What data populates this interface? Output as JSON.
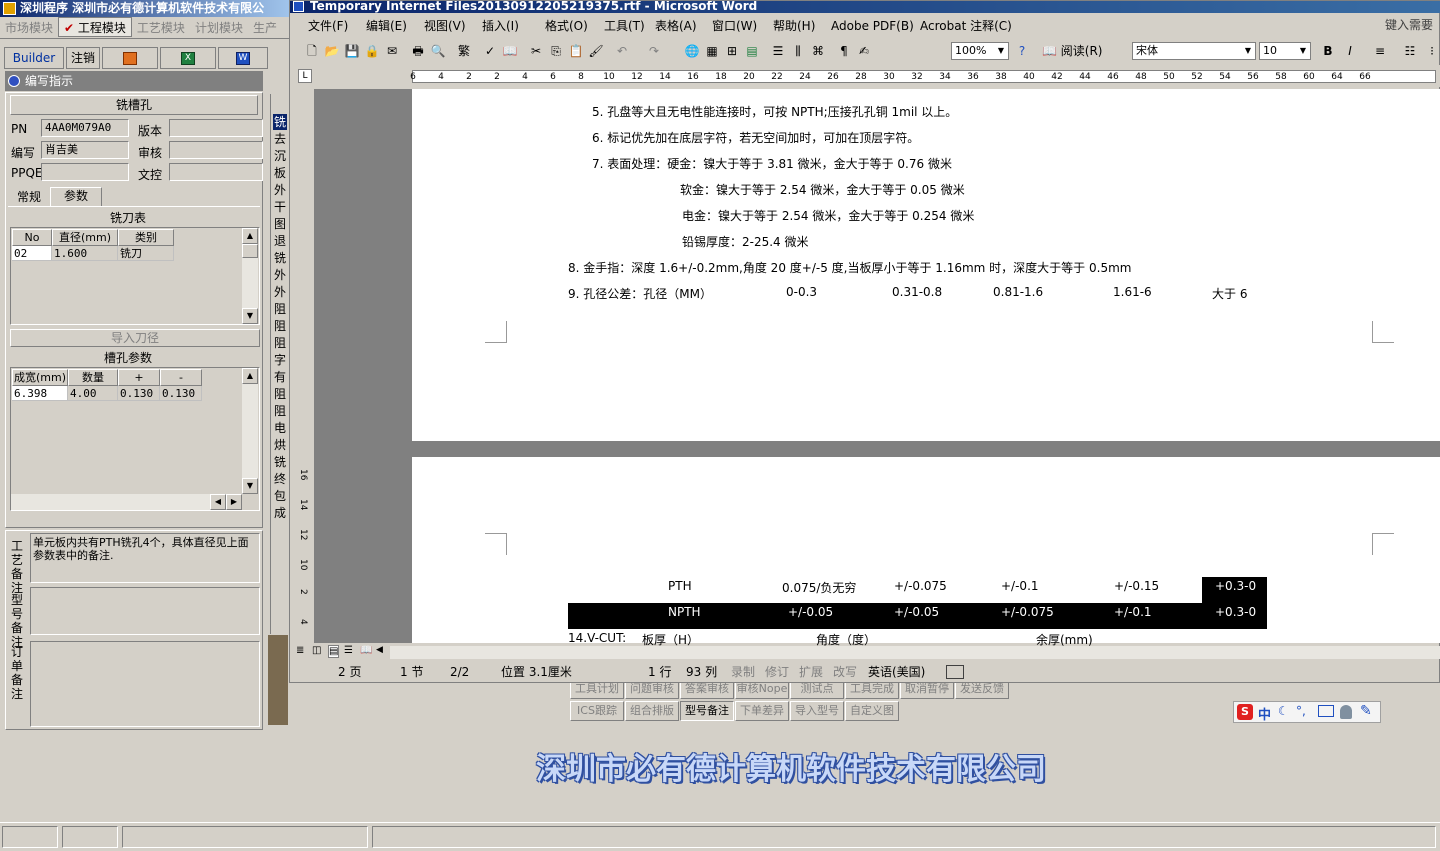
{
  "left_app": {
    "title": "深圳程序   深圳市必有德计算机软件技术有限公",
    "modules": [
      "市场模块",
      "工程模块",
      "工艺模块",
      "计划模块",
      "生产"
    ],
    "toolbar": {
      "builder": "Builder",
      "logout": "注销"
    },
    "panel_title": "编写指示",
    "section_title": "铣槽孔",
    "fields": {
      "pn_label": "PN",
      "pn_value": "4AA0M079A0",
      "version_label": "版本",
      "version_value": "",
      "writer_label": "编写",
      "writer_value": "肖吉美",
      "review_label": "审核",
      "review_value": "",
      "ppqe_label": "PPQE",
      "ppqe_value": "",
      "doccontrol_label": "文控",
      "doccontrol_value": ""
    },
    "tabs": [
      "常规",
      "参数"
    ],
    "mill_table": {
      "title": "铣刀表",
      "headers": [
        "No",
        "直径(mm)",
        "类别"
      ],
      "rows": [
        [
          "02",
          "1.600",
          "铣刀"
        ]
      ]
    },
    "import_button": "导入刀径",
    "slot_table": {
      "title": "槽孔参数",
      "headers": [
        "成宽(mm)",
        "数量",
        "+",
        "-"
      ],
      "rows": [
        [
          "6.398",
          "4.00",
          "0.130",
          "0.130"
        ]
      ]
    },
    "side_strip": [
      "铣",
      "去",
      "沉",
      "板",
      "外",
      "干",
      "图",
      "退",
      "铣",
      "外",
      "外",
      "阻",
      "阻",
      "阻",
      "字",
      "有",
      "阻",
      "阻",
      "电",
      "烘",
      "铣",
      "终",
      "包",
      "成"
    ],
    "notes": {
      "process_label": "工艺备注",
      "process_text": "单元板内共有PTH铣孔4个，具体直径见上面参数表中的备注.",
      "model_label": "型号备注",
      "order_label": "订单备注"
    },
    "bottom_buttons_row1": [
      "工具计划",
      "问题审核",
      "答案审核",
      "审核Nope",
      "测试点",
      "工具完成",
      "取消暂停",
      "发送反馈"
    ],
    "bottom_buttons_row2": [
      "ICS跟踪",
      "组合排版",
      "型号备注",
      "下单差异",
      "导入型号",
      "自定义图"
    ],
    "company": "深圳市必有德计算机软件技术有限公司"
  },
  "word": {
    "title": "Temporary Internet Files20130912205219375.rtf - Microsoft Word",
    "menu": [
      "文件(F)",
      "编辑(E)",
      "视图(V)",
      "插入(I)",
      "格式(O)",
      "工具(T)",
      "表格(A)",
      "窗口(W)",
      "帮助(H)",
      "Adobe PDF(B)",
      "Acrobat 注释(C)"
    ],
    "help_box": "键入需要",
    "zoom": "100%",
    "read_button": "阅读(R)",
    "font_name": "宋体",
    "font_size": "10",
    "ruler_ticks": [
      "6",
      "4",
      "2",
      "2",
      "4",
      "6",
      "8",
      "10",
      "12",
      "14",
      "16",
      "18",
      "20",
      "22",
      "24",
      "26",
      "28",
      "30",
      "32",
      "34",
      "36",
      "38",
      "40",
      "42",
      "44",
      "46",
      "48",
      "50",
      "52",
      "54",
      "56",
      "58",
      "60",
      "64",
      "66"
    ],
    "vruler_ticks": [
      "16",
      "14",
      "12",
      "10",
      "2",
      "4"
    ],
    "doc_lines": [
      "5.  孔盘等大且无电性能连接时，可按 NPTH;压接孔孔铜 1mil 以上。",
      "6.  标记优先加在底层字符，若无空间加时，可加在顶层字符。",
      "7.  表面处理：硬金：镍大于等于 3.81 微米，金大于等于 0.76 微米",
      "软金：镍大于等于 2.54 微米，金大于等于 0.05 微米",
      "电金：镍大于等于 2.54 微米，金大于等于 0.254 微米",
      "铅锡厚度：2-25.4 微米",
      "8.  金手指：深度 1.6+/-0.2mm,角度 20 度+/-5 度,当板厚小于等于 1.16mm 时，深度大于等于 0.5mm"
    ],
    "tolerance": {
      "label": "9.  孔径公差：孔径（MM）",
      "cols": [
        "0-0.3",
        "0.31-0.8",
        "0.81-1.6",
        "1.61-6",
        "大于 6"
      ],
      "pth": [
        "PTH",
        "0.075/负无穷",
        "+/-0.075",
        "+/-0.1",
        "+/-0.15",
        "+0.3-0"
      ],
      "npth": [
        "NPTH",
        "+/-0.05",
        "+/-0.05",
        "+/-0.075",
        "+/-0.1",
        "+0.3-0"
      ]
    },
    "vcut": {
      "label": "14.V-CUT:",
      "col1": "板厚（H）",
      "col2": "角度（度）",
      "col3": "余厚(mm)"
    },
    "status": {
      "page": "2 页",
      "section": "1 节",
      "pages": "2/2",
      "position": "位置 3.1厘米",
      "line": "1 行",
      "column": "93 列",
      "rec": "录制",
      "trk": "修订",
      "ext": "扩展",
      "ovr": "改写",
      "lang": "英语(美国)"
    }
  },
  "ime": {
    "label": "中"
  }
}
